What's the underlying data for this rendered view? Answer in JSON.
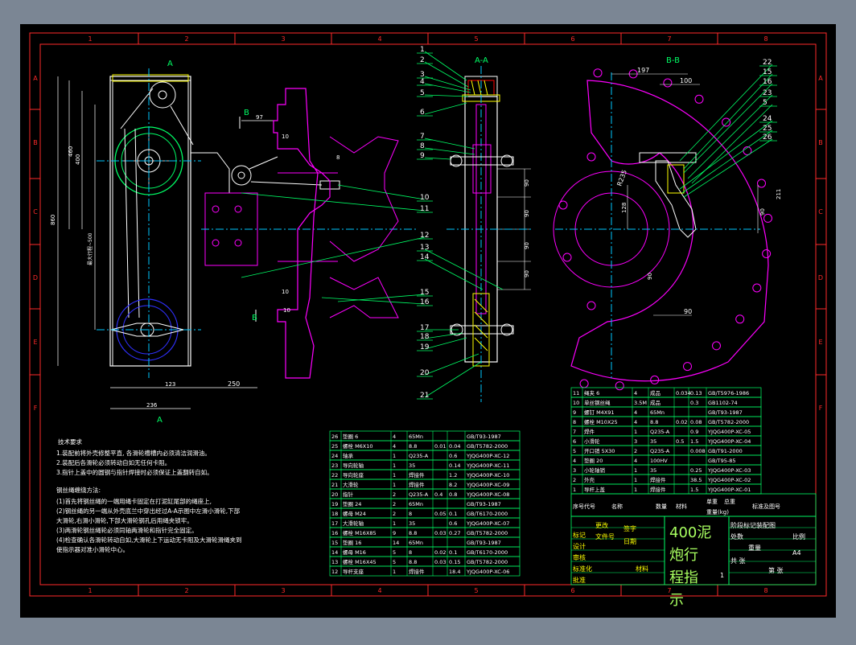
{
  "colors": {
    "background": "#7b8694",
    "canvas": "#000000",
    "border": "#ff2a2a",
    "white": "#ffffff",
    "green": "#00ff66",
    "yellow": "#ffff00",
    "magenta": "#ff00ff",
    "cyan": "#00c8ff",
    "blue": "#3030ff",
    "greenText": "#a8ff60"
  },
  "grid": {
    "cols": [
      "1",
      "2",
      "3",
      "4",
      "5",
      "6",
      "7",
      "8"
    ],
    "rows": [
      "A",
      "B",
      "C",
      "D",
      "E",
      "F"
    ]
  },
  "views": {
    "front_label_top": "A",
    "front_label_bottom": "A",
    "section_aa": "A-A",
    "section_bb": "B-B",
    "b_mark_top": "B",
    "b_mark_bottom": "B"
  },
  "dims": {
    "d460": "460",
    "d400": "400",
    "d860": "860",
    "d_stroke": "最大行程~500",
    "d123": "123",
    "d250": "250",
    "d236": "236",
    "d97": "97",
    "d10a": "10",
    "d10b": "10",
    "d10c": "10",
    "d8": "8",
    "d90a": "90",
    "d90b": "90",
    "d90c": "90",
    "d90d": "90",
    "d197": "197",
    "d100": "100",
    "dR235": "R235",
    "d128": "128",
    "d211": "211",
    "d90e": "90",
    "d90f": "90",
    "d90g": "90"
  },
  "balloons_aa": [
    "1",
    "2",
    "3",
    "4",
    "5",
    "6",
    "7",
    "8",
    "9",
    "10",
    "11",
    "12",
    "13",
    "14",
    "15",
    "16",
    "17",
    "18",
    "19",
    "20",
    "21"
  ],
  "balloons_bb": [
    "22",
    "15",
    "16",
    "23",
    "5",
    "24",
    "25",
    "26"
  ],
  "notes": {
    "tech_title": "技术要求",
    "tech_lines": [
      "1.装配前将外壳修整平直, 各滑轮槽槽内必须清洁润滑油。",
      "2.装配后各滑轮必须转动自如无任何卡阻。",
      "3.指针上盖中的圆钢与指针焊接时必须保证上盖翻转自如。"
    ],
    "rope_title": "钢丝绳缠绕方法:",
    "rope_lines": [
      "(1)首先将钢丝绳的一端用绳卡固定在打泥缸尾部的绳座上,",
      "(2)钢丝绳的另一端从外壳底兰中穿出经过A-A示图中左滑小滑轮,下部",
      "大滑轮,右滑小滑轮,下部大滑轮钢孔后用绳夹锁牢。",
      "(3)两滑轮钢丝绳轮必须同轴两滑轮和指针完全固定。",
      "(4)检查确认各滑轮转动自如,大滑轮上下运动无卡阻及大滑轮滑绳夹到",
      "使指示器对准小滑轮中心。"
    ]
  },
  "bom_left": [
    [
      "26",
      "垫圈 6",
      "4",
      "65Mn",
      "",
      "",
      "GB/T93-1987"
    ],
    [
      "25",
      "螺栓 M6X10",
      "4",
      "8.8",
      "0.01",
      "0.04",
      "GB/T5782-2000"
    ],
    [
      "24",
      "轴承",
      "1",
      "Q235-A",
      "",
      "0.6",
      "YJQG400P-XC-12"
    ],
    [
      "23",
      "导向轮轴",
      "1",
      "35",
      "",
      "0.14",
      "YJQG400P-XC-11"
    ],
    [
      "22",
      "导向轮座",
      "1",
      "焊接件",
      "",
      "1.2",
      "YJQG400P-XC-10"
    ],
    [
      "21",
      "大滑轮",
      "1",
      "焊接件",
      "",
      "8.2",
      "YJQG400P-XC-09"
    ],
    [
      "20",
      "指针",
      "2",
      "Q235-A",
      "0.4",
      "0.8",
      "YJQG400P-XC-08"
    ],
    [
      "19",
      "垫圈 24",
      "2",
      "65Mn",
      "",
      "",
      "GB/T93-1987"
    ],
    [
      "18",
      "螺母 M24",
      "2",
      "8",
      "0.05",
      "0.1",
      "GB/T6170-2000"
    ],
    [
      "17",
      "大滑轮轴",
      "1",
      "35",
      "",
      "0.6",
      "YJQG400P-XC-07"
    ],
    [
      "16",
      "螺栓 M16X85",
      "9",
      "8.8",
      "0.03",
      "0.27",
      "GB/T5782-2000"
    ],
    [
      "15",
      "垫圈 16",
      "14",
      "65Mn",
      "",
      "",
      "GB/T93-1987"
    ],
    [
      "14",
      "螺母 M16",
      "5",
      "8",
      "0.02",
      "0.1",
      "GB/T6170-2000"
    ],
    [
      "13",
      "螺栓 M16X45",
      "5",
      "8.8",
      "0.03",
      "0.15",
      "GB/T5782-2000"
    ],
    [
      "12",
      "导杆支座",
      "1",
      "焊接件",
      "",
      "18.4",
      "YJQG400P-XC-06"
    ]
  ],
  "bom_right": [
    [
      "11",
      "绳夹 6",
      "4",
      "成品",
      "0.034",
      "0.13",
      "GB/T5976-1986"
    ],
    [
      "10",
      "单丝钢丝绳",
      "3.5M",
      "成品",
      "",
      "0.3",
      "GB1102-74"
    ],
    [
      "9",
      "螺钉 M4X91",
      "4",
      "65Mn",
      "",
      "",
      "GB/T93-1987"
    ],
    [
      "8",
      "螺栓 M10X25",
      "4",
      "8.8",
      "0.02",
      "0.08",
      "GB/T5782-2000"
    ],
    [
      "7",
      "焊件",
      "1",
      "Q235-A",
      "",
      "0.9",
      "YJQG400P-XC-05"
    ],
    [
      "6",
      "小滑轮",
      "3",
      "35",
      "0.5",
      "1.5",
      "YJQG400P-XC-04"
    ],
    [
      "5",
      "开口销 5X30",
      "2",
      "Q235-A",
      "",
      "0.008",
      "GB/T91-2000"
    ],
    [
      "4",
      "垫圈 20",
      "4",
      "100HV",
      "",
      "",
      "GB/T95-85"
    ],
    [
      "3",
      "小轮轴销",
      "1",
      "35",
      "",
      "0.25",
      "YJQG400P-XC-03"
    ],
    [
      "2",
      "外壳",
      "1",
      "焊接件",
      "",
      "38.5",
      "YJQG400P-XC-02"
    ],
    [
      "1",
      "导杆上盖",
      "1",
      "焊接件",
      "",
      "1.5",
      "YJQG400P-XC-01"
    ]
  ],
  "bom_header": {
    "seq": "序号",
    "code": "代号",
    "name": "名称",
    "qty": "数量",
    "material": "材料",
    "single": "单重",
    "total": "总重",
    "weight": "重量(kg)",
    "ref": "标准及图号"
  },
  "title_block": {
    "title_line1": "400泥",
    "title_line2": "炮行",
    "title_line3": "程指",
    "title_line4": "示",
    "designer": "设计",
    "checker": "审核",
    "standard": "标准化",
    "approve": "批准",
    "change": "更改",
    "doc_no": "文件号",
    "sign": "签字",
    "date": "日期",
    "mark": "标记",
    "count": "处数",
    "stage": "阶段标记",
    "weight": "重量",
    "scale": "比例",
    "sheet": "第 张",
    "sheets": "共 张",
    "material_label": "材料",
    "scale_val": "1",
    "assembly": "装配图",
    "paper": "A4"
  }
}
